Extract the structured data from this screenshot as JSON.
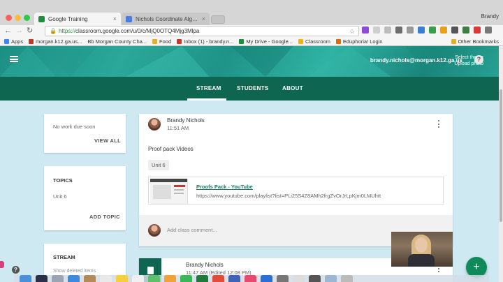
{
  "browser": {
    "tabs": [
      {
        "title": "Google Training",
        "active": true,
        "favicon_color": "#1e8e3e"
      },
      {
        "title": "Nichols Coordinate Algebra Pl",
        "active": false,
        "favicon_color": "#4a7be0"
      }
    ],
    "close_glyph": "×",
    "profile_name": "Brandy",
    "url_scheme": "https://",
    "url_rest": "classroom.google.com/u/0/c/MjQ0OTQ4Mjg3Mlpa",
    "bookmarks": [
      {
        "label": "Apps",
        "color": "#4285f4"
      },
      {
        "label": "morgan.k12.ga.us...",
        "color": "#c0392b"
      },
      {
        "label": "Bb  Morgan County Cha...",
        "color": "#222222"
      },
      {
        "label": "Food",
        "color": "#e0b030"
      },
      {
        "label": "Inbox (1) - brandy.n...",
        "color": "#d93025"
      },
      {
        "label": "My Drive - Google...",
        "color": "#1e8e3e"
      },
      {
        "label": "Classroom",
        "color": "#f4b400"
      },
      {
        "label": "Eduphoria! Login",
        "color": "#e06c00"
      }
    ],
    "other_bookmarks": "Other Bookmarks"
  },
  "header": {
    "user_email": "brandy.nichols@morgan.k12.ga.us",
    "select_theme": "Select theme",
    "upload_photo": "Upload photo",
    "help": "?"
  },
  "nav": {
    "tabs": [
      {
        "label": "STREAM",
        "active": true
      },
      {
        "label": "STUDENTS",
        "active": false
      },
      {
        "label": "ABOUT",
        "active": false
      }
    ]
  },
  "sidebar": {
    "upcoming": {
      "empty_text": "No work due soon",
      "view_all": "VIEW ALL"
    },
    "topics": {
      "heading": "TOPICS",
      "items": [
        "Unit 6"
      ],
      "add_topic": "ADD TOPIC"
    },
    "stream": {
      "heading": "STREAM",
      "show_deleted": "Show deleted items"
    }
  },
  "posts": [
    {
      "author": "Brandy Nichols",
      "time": "11:51 AM",
      "text": "Proof pack Videos",
      "topic_chip": "Unit 6",
      "attachment": {
        "title": "Proofs Pack - YouTube",
        "url": "https://www.youtube.com/playlist?list=PLi25S4Z8AMh2frgZvOrJrLpKjm0LMUhtt"
      },
      "comment_placeholder": "Add class comment..."
    },
    {
      "author": "Brandy Nichols",
      "time": "11:47 AM (Edited 12:08 PM)"
    }
  ],
  "fab_label": "+",
  "colors": {
    "primary": "#0f6650",
    "banner": "#2aa89a",
    "background": "#cfe9f2",
    "link": "#1a7a5e"
  }
}
